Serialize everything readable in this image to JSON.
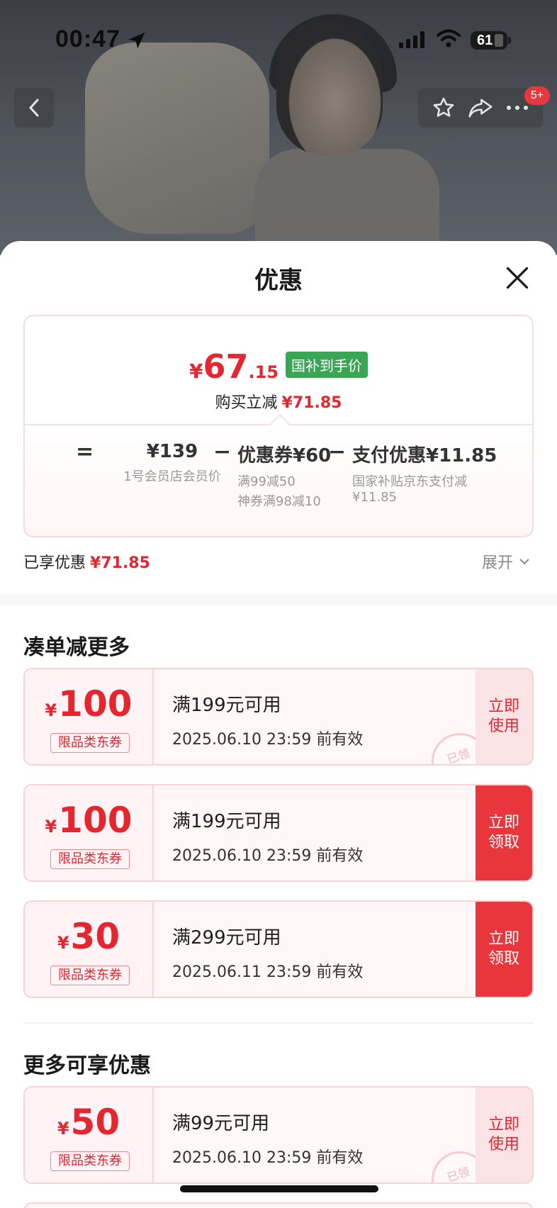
{
  "status_bar": {
    "time": "00:47",
    "battery": "61"
  },
  "nav": {
    "badge": "5+"
  },
  "sheet": {
    "title": "优惠"
  },
  "price_card": {
    "currency": "¥",
    "final_int": "67",
    "final_dec": ".15",
    "tag": "国补到手价",
    "cut_label": "购买立减",
    "cut_value": "¥71.85",
    "eq_op": "=",
    "base_price": "¥139",
    "base_desc": "1号会员店会员价",
    "minus1": "−",
    "coupon_label": "优惠券¥60",
    "coupon_desc1": "满99减50",
    "coupon_desc2": "神券满98减10",
    "minus2": "−",
    "pay_label": "支付优惠¥11.85",
    "pay_desc1": "国家补贴京东支付减",
    "pay_desc2": "¥11.85"
  },
  "enjoyed": {
    "label": "已享优惠",
    "value": "¥71.85",
    "expand": "展开"
  },
  "section1": {
    "title": "凑单减更多"
  },
  "section2": {
    "title": "更多可享优惠"
  },
  "coupons": [
    {
      "currency": "¥",
      "amount": "100",
      "type": "限品类东券",
      "condition": "满199元可用",
      "validity": "2025.06.10 23:59 前有效",
      "action": "立即\n使用",
      "action_line1": "立即",
      "action_line2": "使用",
      "stamp": "已领"
    },
    {
      "currency": "¥",
      "amount": "100",
      "type": "限品类东券",
      "condition": "满199元可用",
      "validity": "2025.06.10 23:59 前有效",
      "action_line1": "立即",
      "action_line2": "领取"
    },
    {
      "currency": "¥",
      "amount": "30",
      "type": "限品类东券",
      "condition": "满299元可用",
      "validity": "2025.06.11 23:59 前有效",
      "action_line1": "立即",
      "action_line2": "领取"
    },
    {
      "currency": "¥",
      "amount": "50",
      "type": "限品类东券",
      "condition": "满99元可用",
      "validity": "2025.06.10 23:59 前有效",
      "action_line1": "立即",
      "action_line2": "使用",
      "stamp": "已领"
    }
  ],
  "colors": {
    "accent_red": "#e3262f",
    "green_tag": "#3aa655",
    "get_button": "#e8363c"
  }
}
